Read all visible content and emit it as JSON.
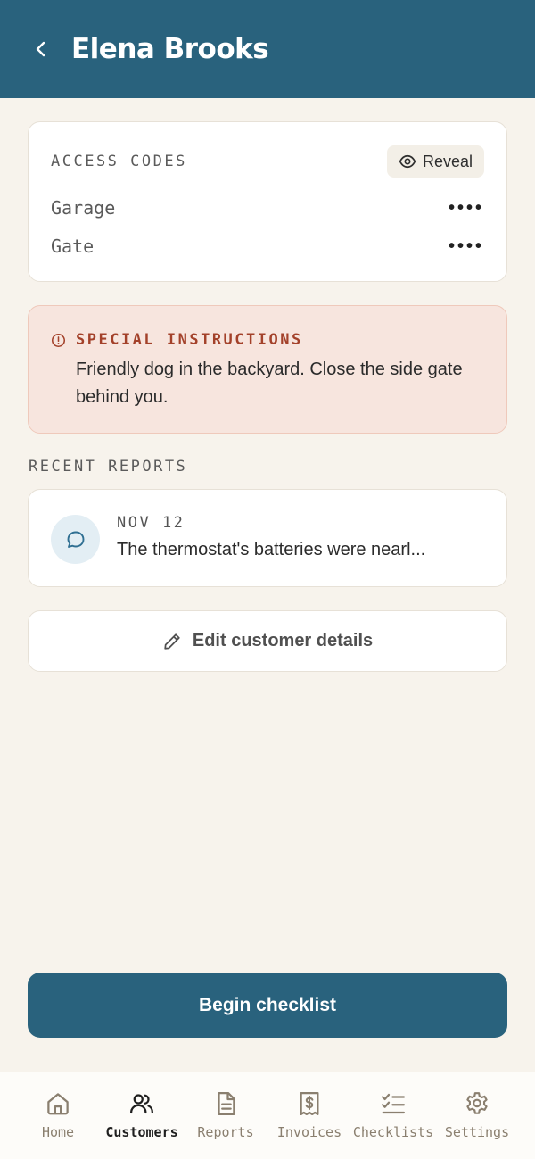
{
  "header": {
    "title": "Elena Brooks"
  },
  "access_codes": {
    "label": "ACCESS CODES",
    "reveal_label": "Reveal",
    "codes": [
      {
        "label": "Garage",
        "value": "••••"
      },
      {
        "label": "Gate",
        "value": "••••"
      }
    ]
  },
  "special_instructions": {
    "label": "SPECIAL INSTRUCTIONS",
    "text": "Friendly dog in the backyard. Close the side gate behind you."
  },
  "recent_reports": {
    "label": "RECENT REPORTS",
    "items": [
      {
        "date": "NOV 12",
        "preview": "The thermostat's batteries were nearl..."
      }
    ]
  },
  "edit_label": "Edit customer details",
  "cta_label": "Begin checklist",
  "tabs": [
    {
      "label": "Home",
      "icon": "home-icon",
      "active": false
    },
    {
      "label": "Customers",
      "icon": "users-icon",
      "active": true
    },
    {
      "label": "Reports",
      "icon": "document-icon",
      "active": false
    },
    {
      "label": "Invoices",
      "icon": "receipt-dollar-icon",
      "active": false
    },
    {
      "label": "Checklists",
      "icon": "checklist-icon",
      "active": false
    },
    {
      "label": "Settings",
      "icon": "gear-icon",
      "active": false
    }
  ],
  "colors": {
    "primary": "#29627d",
    "background": "#f7f3ec",
    "alert_bg": "#f7e5de",
    "alert_text": "#a3412a",
    "tab_inactive": "#8a7f6f"
  }
}
